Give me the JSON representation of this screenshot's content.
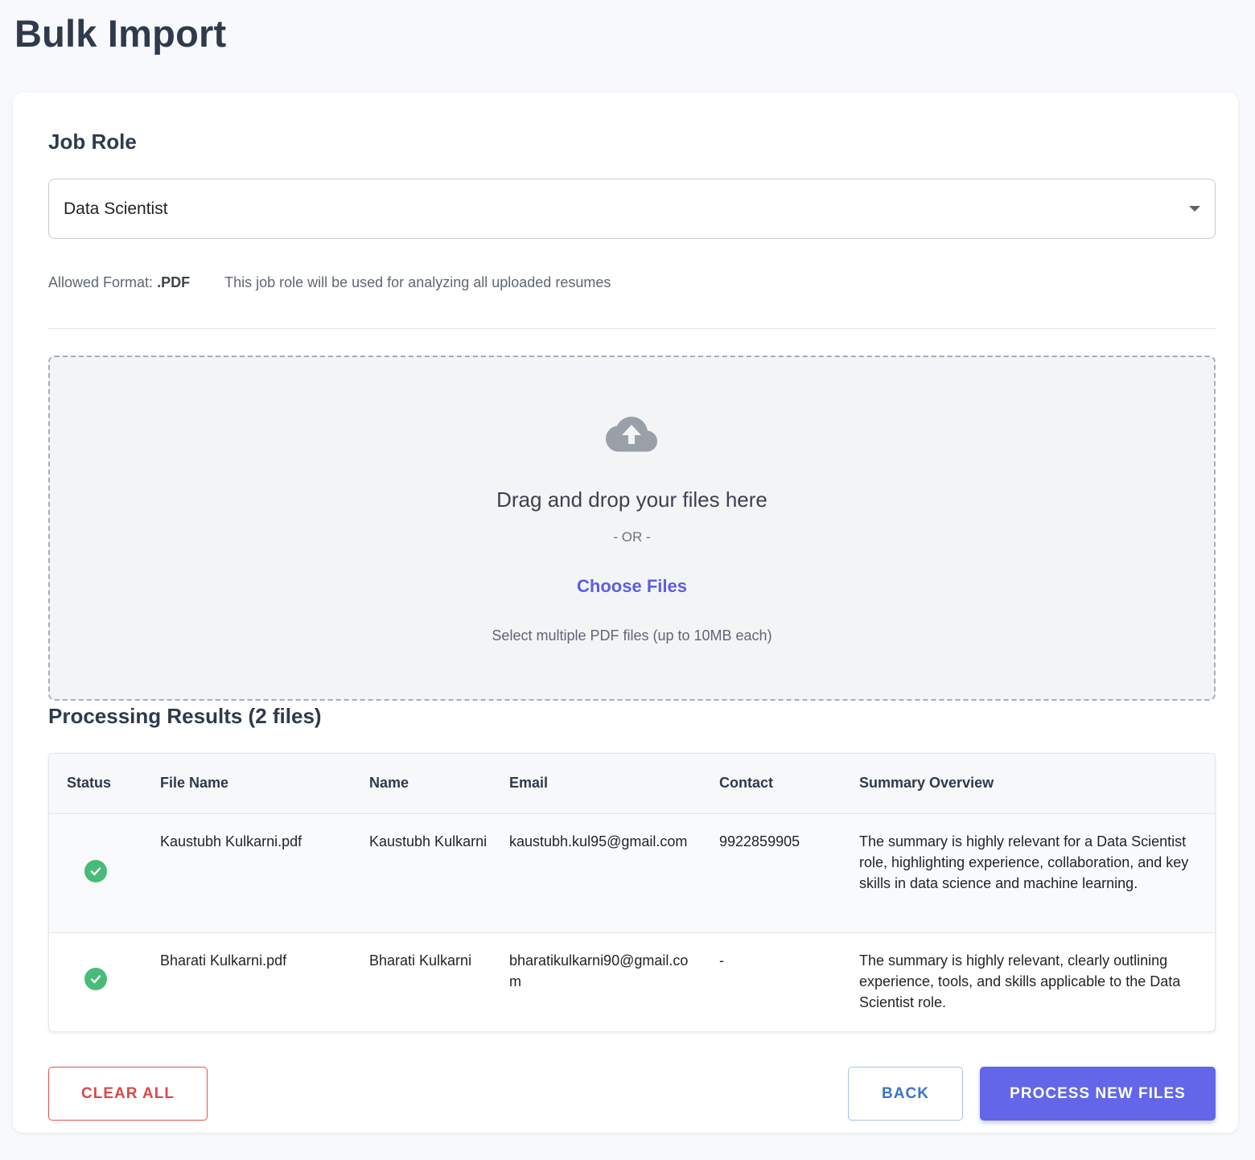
{
  "page": {
    "title": "Bulk Import"
  },
  "job_role": {
    "section_title": "Job Role",
    "selected": "Data Scientist",
    "allowed_format_label": "Allowed Format:",
    "allowed_format_value": ".PDF",
    "helper_text": "This job role will be used for analyzing all uploaded resumes"
  },
  "dropzone": {
    "icon": "cloud-upload-icon",
    "title": "Drag and drop your files here",
    "or_text": "- OR -",
    "choose_label": "Choose Files",
    "hint": "Select multiple PDF files (up to 10MB each)"
  },
  "results": {
    "title": "Processing Results (2 files)",
    "columns": [
      "Status",
      "File Name",
      "Name",
      "Email",
      "Contact",
      "Summary Overview"
    ],
    "rows": [
      {
        "status": "success",
        "file_name": "Kaustubh Kulkarni.pdf",
        "name": "Kaustubh Kulkarni",
        "email": "kaustubh.kul95@gmail.com",
        "contact": "9922859905",
        "summary": "The summary is highly relevant for a Data Scientist role, highlighting experience, collaboration, and key skills in data science and machine learning."
      },
      {
        "status": "success",
        "file_name": "Bharati Kulkarni.pdf",
        "name": "Bharati Kulkarni",
        "email": "bharatikulkarni90@gmail.com",
        "contact": "-",
        "summary": "The summary is highly relevant, clearly outlining experience, tools, and skills applicable to the Data Scientist role."
      }
    ]
  },
  "actions": {
    "clear_label": "CLEAR ALL",
    "back_label": "BACK",
    "process_label": "PROCESS NEW FILES"
  },
  "colors": {
    "primary": "#6366e8",
    "danger": "#d94848",
    "success": "#48bb78",
    "link": "#5b5ee0"
  }
}
